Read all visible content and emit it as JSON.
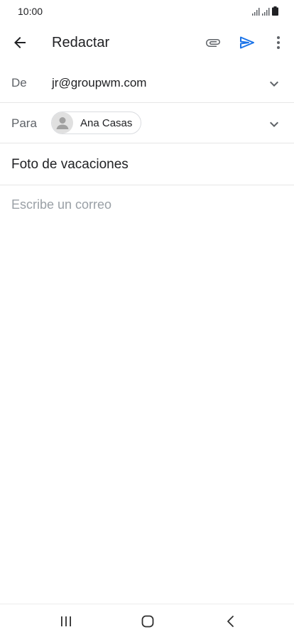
{
  "status_bar": {
    "time": "10:00"
  },
  "toolbar": {
    "title": "Redactar",
    "accent_color": "#1a73e8"
  },
  "from_field": {
    "label": "De",
    "value": "jr@groupwm.com"
  },
  "to_field": {
    "label": "Para",
    "recipients": [
      {
        "name": "Ana Casas"
      }
    ]
  },
  "subject_field": {
    "value": "Foto de vacaciones"
  },
  "body_field": {
    "placeholder": "Escribe un correo"
  },
  "icons": {
    "back": "arrow-left-icon",
    "attach": "paperclip-icon",
    "send": "send-icon",
    "more": "more-vert-icon",
    "chevron": "chevron-down-icon",
    "avatar": "person-icon"
  }
}
